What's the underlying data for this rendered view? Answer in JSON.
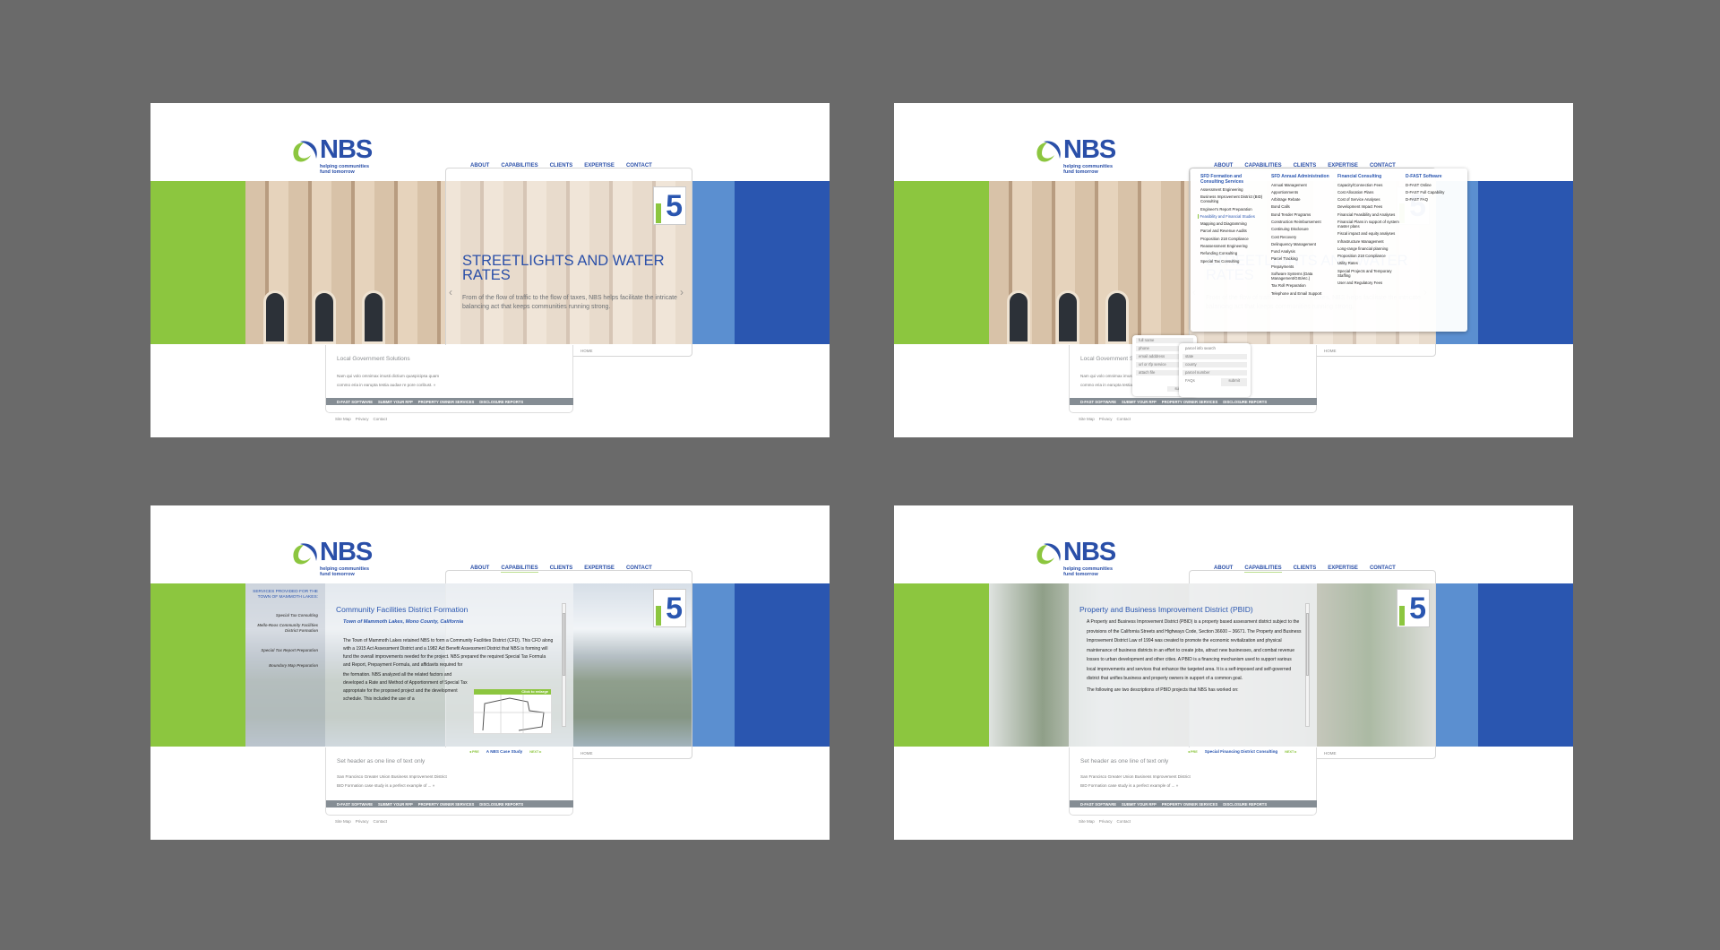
{
  "site": {
    "logo_text": "NBS",
    "tagline": [
      "helping communities",
      "fund tomorrow"
    ],
    "nav": [
      "ABOUT",
      "CAPABILITIES",
      "CLIENTS",
      "EXPERTISE",
      "CONTACT"
    ],
    "home_label": "HOME",
    "badge_text": "5",
    "footer_bar": [
      "D-FAST SOFTWARE",
      "SUBMIT YOUR RFP",
      "PROPERTY OWNER SERVICES",
      "DISCLOSURE REPORTS"
    ],
    "footer_links": [
      "Site Map",
      "Privacy",
      "Contact"
    ],
    "colors": {
      "green": "#8cc63f",
      "blue": "#2a56b0",
      "light_blue": "#5b8fd0",
      "bar_gray": "#858d94"
    }
  },
  "hero": {
    "headline": "STREETLIGHTS AND WATER RATES",
    "body": "From of the flow of traffic to the flow of taxes, NBS helps facilitate the intricate balancing act that keeps communities running strong.",
    "lower_title": "Local Government Solutions",
    "lower_body": [
      "Nam qui volo omnimax imusti dictium quaspicipsa quam",
      "commo eria in earupta testia audae re pore coribust.  »"
    ]
  },
  "case_lower": {
    "title": "Set header as one line of text only",
    "body": [
      "San Francisco Greater Union Business Improvement District",
      "BID Formation case study is a perfect example of ...   »"
    ]
  },
  "capabilities_menu": {
    "columns": [
      {
        "heading": "SFD Formation and Consulting Services",
        "items": [
          "Assessment Engineering",
          "Business Improvement District (BID) Consulting",
          "Engineer's Report Preparation",
          "Feasibility and Financial Studies",
          "Mapping and Diagramming",
          "Parcel and Revenue Audits",
          "Proposition 218 Compliance",
          "Reassessment Engineering",
          "Refunding Consulting",
          "Special Tax Consulting"
        ],
        "selected": "Feasibility and Financial Studies"
      },
      {
        "heading": "SFD Annual Administration",
        "items": [
          "Annual Management",
          "Apportionments",
          "Arbitrage Rebate",
          "Bond Calls",
          "Bond Tender Programs",
          "Construction Reimbursement",
          "Continuing Disclosure",
          "Cost Recovery",
          "Delinquency Management",
          "Fund Analysis",
          "Parcel Tracking",
          "Prepayments",
          "Software Systems (Data Management/GIS/etc.)",
          "Tax Roll Preparation",
          "Telephone and Email Support"
        ]
      },
      {
        "heading": "Financial Consulting",
        "items": [
          "Capacity/Connection Fees",
          "Cost Allocation Plans",
          "Cost of Service Analyses",
          "Development Impact Fees",
          "Financial Feasibility and Analyses",
          "Financial Plans in support of system master plans",
          "Fiscal impact and equity analyses",
          "Infrastructure Management",
          "Long-range financial planning",
          "Proposition 218 Compliance",
          "Utility Rates",
          "Special Projects and Temporary Staffing",
          "User and Regulatory Fees"
        ]
      },
      {
        "heading": "D-FAST Software",
        "items": [
          "D-FAST Online",
          "D-FAST Full Capability",
          "D-FAST FAQ"
        ]
      }
    ]
  },
  "rfp_form": {
    "fields": [
      "full name",
      "phone",
      "email adddress",
      "url or rfp service",
      "attach file"
    ],
    "submit": "submit"
  },
  "parcel_form": {
    "title": "parcel info search",
    "fields": [
      "state",
      "county",
      "parcel number"
    ],
    "faqs": "FAQs",
    "submit": "submit"
  },
  "cfd_page": {
    "sidebar_heading": "SERVICES PROVIDED FOR THE TOWN OF MAMMOTH LAKES:",
    "sidebar_items": [
      "Special Tax Consulting",
      "Mello-Roos Community Facilities District Formation",
      "Special Tax Report Preparation",
      "Boundary Map Preparation"
    ],
    "title": "Community Facilities District Formation",
    "subtitle": "Town of Mammoth Lakes, Mono County, California",
    "body1": "The Town of Mammoth Lakes retained NBS to form a Community Facilities District (CFD). This CFD along with a 1915 Act Assessment District and a 1982 Act Benefit Assessment District that NBS is forming will fund the overall improvements needed for the project. NBS prepared the required Special Tax Formula and Report, Prepayment Formula, and affidavits required for",
    "body2": "the formation. NBS analyzed all the related factors and developed a Rate and Method of Apportionment of Special Tax appropriate for the proposed project and the development schedule. This included the use of a",
    "map_label": "Click to enlarge",
    "prev": "◂ PRE",
    "case_label": "A NBS Case Study",
    "next": "NEXT ▸"
  },
  "pbid_page": {
    "title": "Property and Business Improvement District (PBID)",
    "body1": "A Property and Business Improvement District (PBID) is a property based assessment district subject to the provisions of the California Streets and Highways Code, Section 36600 – 36671. The Property and Business Improvement District Law of 1994 was created to promote the economic revitalization and physical maintenance of business districts in an effort to create jobs, attract new businesses, and combat revenue losses to urban development and other cities. A PBID is a financing mechanism used to support various local improvements and services that enhance the targeted area. It is a self-imposed and self-governed district that unifies business and property owners in support of a common goal.",
    "body2": "The following are two descriptions of PBID projects that NBS has worked on:",
    "prev": "◂ PRE",
    "case_label": "Special Financing District Consulting",
    "next": "NEXT ▸"
  }
}
